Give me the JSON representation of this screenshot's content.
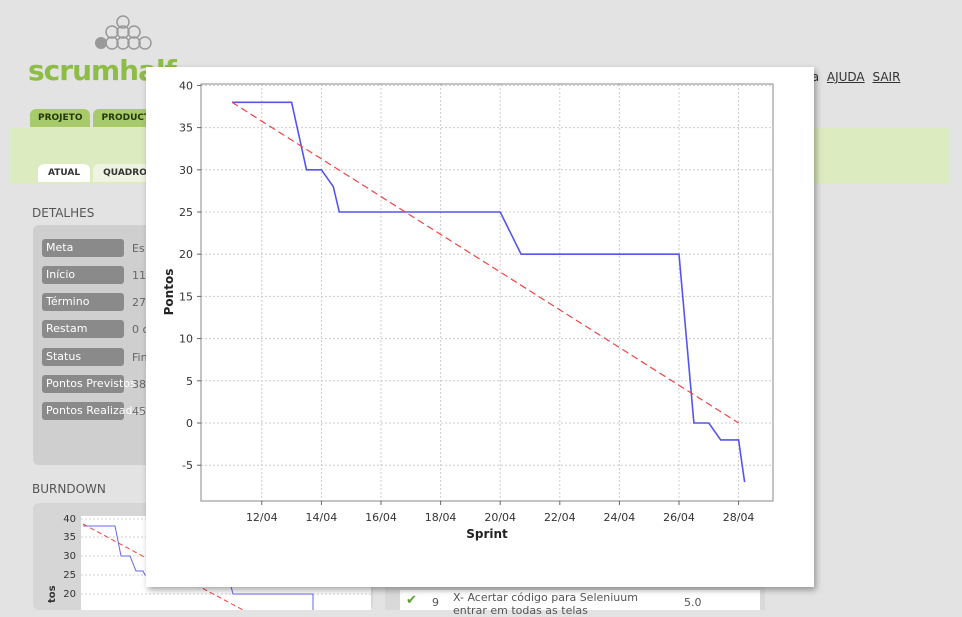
{
  "brand": {
    "name": "scrumhalf"
  },
  "topnav": {
    "partial": "ma",
    "help": "AJUDA",
    "logout": "SAIR"
  },
  "tabs_main": [
    "PROJETO",
    "PRODUCT"
  ],
  "tabs_sub": [
    "ATUAL",
    "QUADRO DE"
  ],
  "details": {
    "title": "DETALHES",
    "rows": [
      {
        "label": "Meta",
        "value": "Es"
      },
      {
        "label": "Início",
        "value": "11"
      },
      {
        "label": "Término",
        "value": "27"
      },
      {
        "label": "Restam",
        "value": "0 c"
      },
      {
        "label": "Status",
        "value": "Fin"
      },
      {
        "label": "Pontos Previstos",
        "value": "38"
      },
      {
        "label": "Pontos Realizados",
        "value": "45"
      }
    ]
  },
  "burndown_section": {
    "title": "BURNDOWN",
    "ylabel_partial": "tos",
    "ticks": [
      "40",
      "35",
      "30",
      "25",
      "20"
    ]
  },
  "task": {
    "number": "9",
    "text": "X- Acertar código para Seleniuum",
    "text2": "entrar em todas as telas",
    "points": "5.0"
  },
  "colors": {
    "actual": "#5555ee",
    "ideal": "#ee4444",
    "accent": "#8ebd47"
  },
  "chart_data": {
    "type": "line",
    "title": "",
    "xlabel": "Sprint",
    "ylabel": "Pontos",
    "x_unit": "day of month (April)",
    "xlim": [
      11,
      29
    ],
    "ylim": [
      -8,
      40
    ],
    "xticks": [
      "12/04",
      "14/04",
      "16/04",
      "18/04",
      "20/04",
      "22/04",
      "24/04",
      "26/04",
      "28/04"
    ],
    "xtick_values": [
      12,
      14,
      16,
      18,
      20,
      22,
      24,
      26,
      28
    ],
    "yticks": [
      40,
      35,
      30,
      25,
      20,
      15,
      10,
      5,
      0,
      -5
    ],
    "grid": true,
    "legend": "none",
    "series": [
      {
        "color": "#5555ee",
        "style": "solid",
        "x": [
          11,
          13,
          13.5,
          14,
          14.4,
          14.6,
          14.8,
          20,
          20.7,
          26,
          26.5,
          27,
          27.4,
          28,
          28,
          28.2
        ],
        "y": [
          38,
          38,
          30,
          30,
          28,
          25,
          25,
          25,
          20,
          20,
          0,
          0,
          -2,
          -2,
          -2,
          -7
        ]
      },
      {
        "color": "#ee4444",
        "style": "dashed",
        "x": [
          11,
          28
        ],
        "y": [
          38,
          0
        ]
      }
    ]
  }
}
